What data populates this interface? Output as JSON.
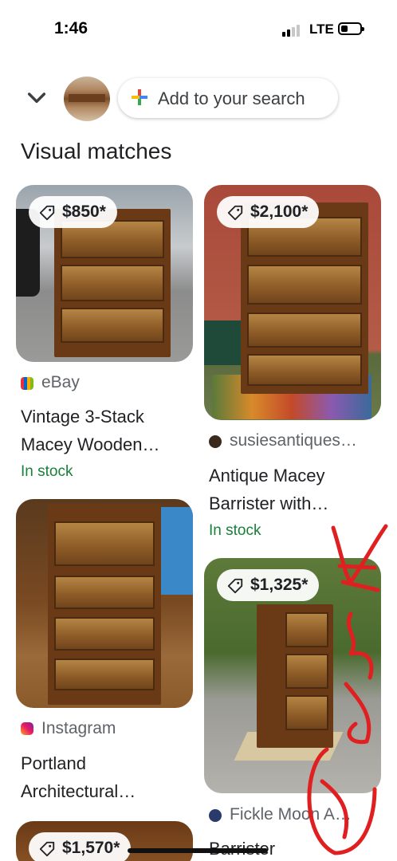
{
  "status": {
    "time": "1:46",
    "network": "LTE",
    "battery_level": 0.3,
    "signal_bars": 2
  },
  "search": {
    "add_label": "Add to your search"
  },
  "section": {
    "title": "Visual matches"
  },
  "results": [
    {
      "price": "$850*",
      "source": "eBay",
      "title": "Vintage 3-Stack Macey Wooden…",
      "stock": "In stock",
      "icon": "ebay-logo-icon"
    },
    {
      "price": "$2,100*",
      "source": "susiesantiques…",
      "title": "Antique Macey Barrister with…",
      "stock": "In stock",
      "icon": "susiesantiques-logo-icon"
    },
    {
      "price": "",
      "source": "Instagram",
      "title": "Portland Architectural…",
      "stock": "",
      "icon": "instagram-logo-icon"
    },
    {
      "price": "$1,325*",
      "source": "Fickle Moon A…",
      "title": "Barrister",
      "stock": "",
      "icon": "fickle-moon-logo-icon"
    },
    {
      "price": "$1,570*",
      "source": "",
      "title": "",
      "stock": "",
      "icon": ""
    }
  ],
  "colors": {
    "accent_plus": [
      "#4285f4",
      "#ea4335",
      "#fbbc04",
      "#34a853"
    ],
    "in_stock": "#188038",
    "annotation": "#e02020"
  }
}
